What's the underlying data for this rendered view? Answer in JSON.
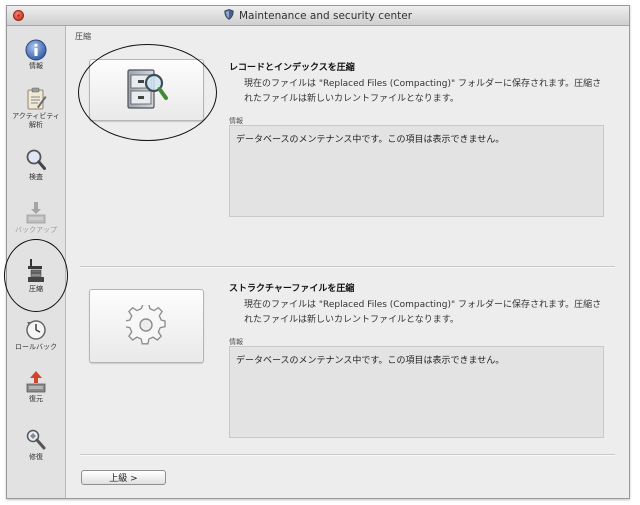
{
  "window": {
    "title": "Maintenance and security center"
  },
  "sidebar": {
    "items": [
      {
        "label": "情報",
        "icon": "info-icon",
        "enabled": true
      },
      {
        "label": "アクティビティ\n解析",
        "icon": "clipboard-icon",
        "enabled": true
      },
      {
        "label": "検査",
        "icon": "magnifier-icon",
        "enabled": true
      },
      {
        "label": "バックアップ",
        "icon": "backup-icon",
        "enabled": false
      },
      {
        "label": "圧縮",
        "icon": "compact-icon",
        "enabled": true,
        "selected": true
      },
      {
        "label": "ロールバック",
        "icon": "rollback-clock-icon",
        "enabled": true
      },
      {
        "label": "復元",
        "icon": "restore-icon",
        "enabled": true
      },
      {
        "label": "修復",
        "icon": "repair-icon",
        "enabled": true
      }
    ]
  },
  "main": {
    "section_label": "圧縮",
    "cards": [
      {
        "title": "レコードとインデックスを圧縮",
        "description": "現在のファイルは \"Replaced Files (Compacting)\" フォルダーに保存されます。圧縮されたファイルは新しいカレントファイルとなります。",
        "info_label": "情報",
        "info_text": "データベースのメンテナンス中です。この項目は表示できません。",
        "button_icon": "file-cabinet-magnifier-icon"
      },
      {
        "title": "ストラクチャーファイルを圧縮",
        "description": "現在のファイルは \"Replaced Files (Compacting)\" フォルダーに保存されます。圧縮されたファイルは新しいカレントファイルとなります。",
        "info_label": "情報",
        "info_text": "データベースのメンテナンス中です。この項目は表示できません。",
        "button_icon": "gear-icon"
      }
    ],
    "up_button_label": "上級 >"
  },
  "colors": {
    "title_bar": "#d9d9d9",
    "sidebar_bg": "#e2e2e2",
    "info_box_bg": "#e3e3e3",
    "close_button": "#d43a26"
  }
}
